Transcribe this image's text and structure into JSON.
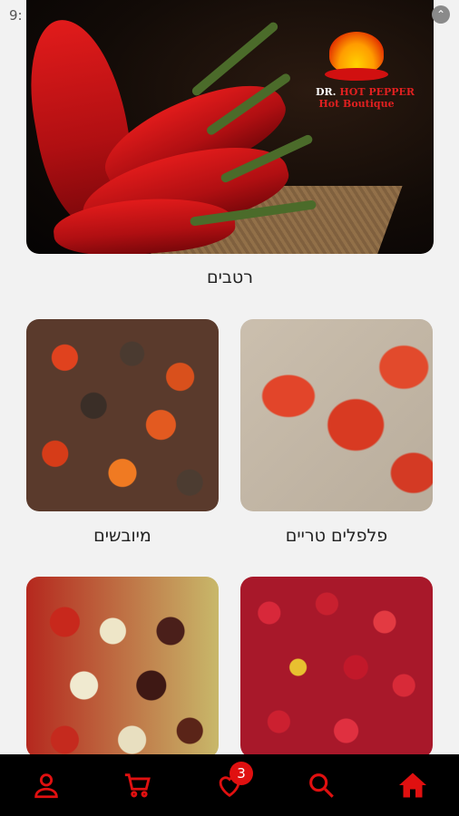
{
  "status": {
    "time": "9:",
    "icon": "info-icon"
  },
  "hero": {
    "logo_line1_part1": "DR.",
    "logo_line1_hot": "HOT PEPPER",
    "logo_line2": "Hot Boutique",
    "label": "רטבים"
  },
  "categories": [
    {
      "label": "מיובשים"
    },
    {
      "label": "פלפלים טריים"
    }
  ],
  "nav": {
    "items": [
      "profile-icon",
      "cart-icon",
      "heart-icon",
      "search-icon",
      "home-icon"
    ],
    "favorites_count": "3",
    "accent": "#e01010"
  }
}
